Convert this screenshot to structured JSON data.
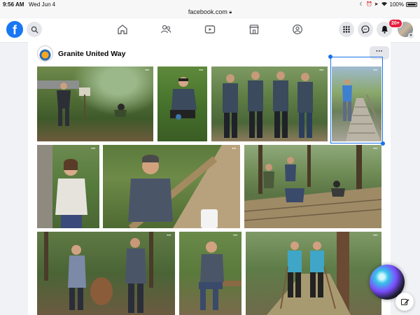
{
  "status_bar": {
    "time": "9:56 AM",
    "date": "Wed Jun 4",
    "battery_text": "100%",
    "battery_level": 1.0
  },
  "browser": {
    "url": "facebook.com"
  },
  "nav": {
    "notification_badge": "20+",
    "icons": [
      "facebook-logo-icon",
      "search-icon",
      "home-icon",
      "friends-icon",
      "video-icon",
      "marketplace-icon",
      "groups-icon",
      "menu-grid-icon",
      "messenger-icon",
      "bell-icon"
    ]
  },
  "page": {
    "name": "Granite United Way",
    "more_label": "···"
  },
  "gallery": {
    "photo_menu_label": "···",
    "photos": [
      {
        "scene": "volunteer-planting-near-sign"
      },
      {
        "scene": "volunteer-kneeling-smiling"
      },
      {
        "scene": "group-of-four-volunteers"
      },
      {
        "scene": "volunteer-on-boardwalk"
      },
      {
        "scene": "volunteer-woman-smiling"
      },
      {
        "scene": "volunteer-man-painting-rail"
      },
      {
        "scene": "volunteers-building-boardwalk"
      },
      {
        "scene": "volunteers-with-tree-stump"
      },
      {
        "scene": "volunteer-sitting-on-bench"
      },
      {
        "scene": "volunteers-holding-rakes"
      }
    ]
  },
  "colors": {
    "brand": "#1877f2",
    "badge": "#e41e3f",
    "selection": "#1a73e8"
  }
}
